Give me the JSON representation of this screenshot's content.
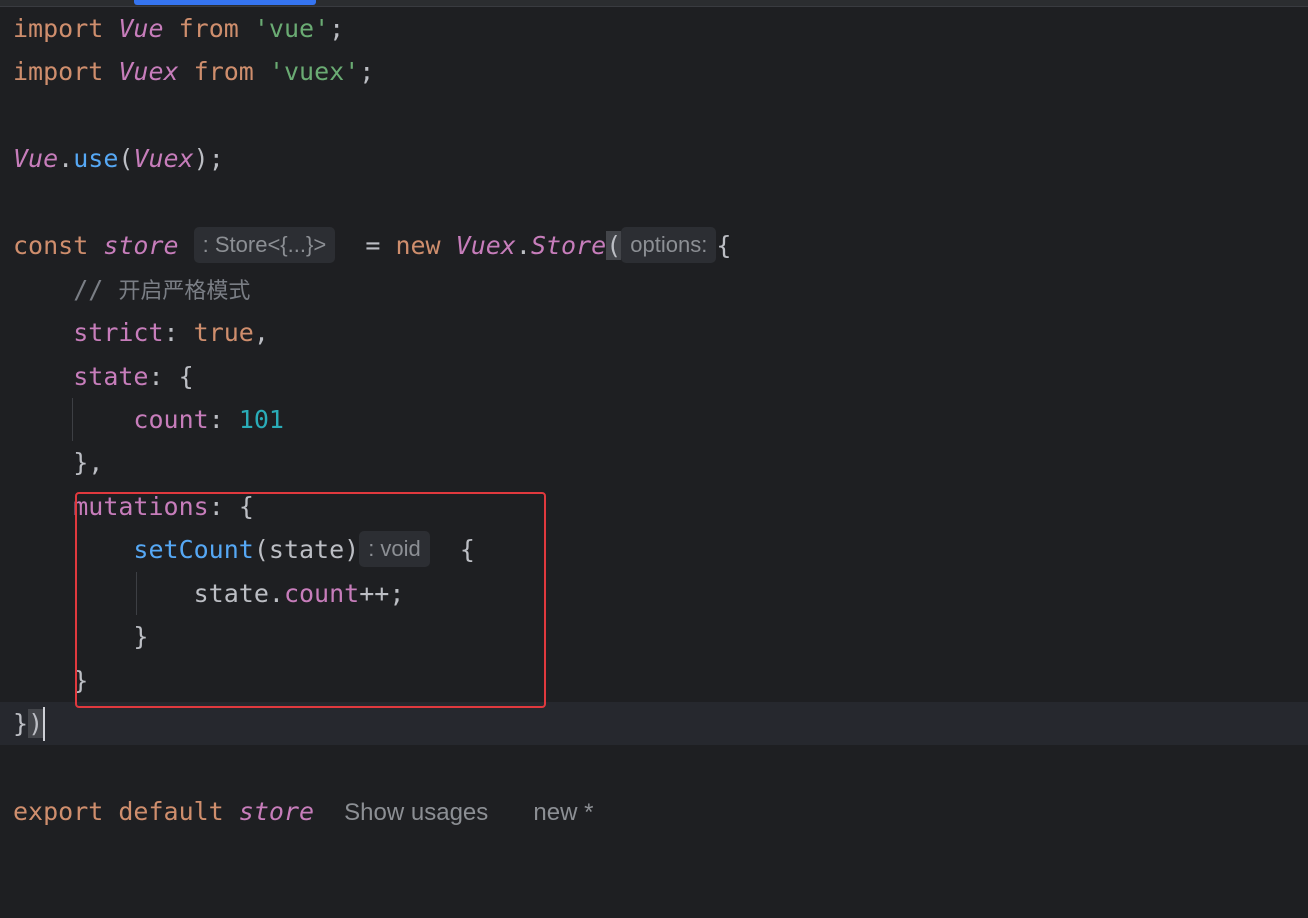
{
  "editor": {
    "lines": {
      "l1": {
        "kw": "import",
        "cls": "Vue",
        "kw2": "from",
        "str": "'vue'",
        "end": ";"
      },
      "l2": {
        "kw": "import",
        "cls": "Vuex",
        "kw2": "from",
        "str": "'vuex'",
        "end": ";"
      },
      "l4": {
        "cls": "Vue",
        "dot": ".",
        "fn": "use",
        "open": "(",
        "arg": "Vuex",
        "close": ");"
      },
      "l6": {
        "kw": "const",
        "var": "store",
        "type_hint": ": Store<{...}>",
        "eq": "=",
        "kw2": "new",
        "cls": "Vuex",
        "dot": ".",
        "ctor": "Store",
        "paren": "(",
        "param_hint": "options:",
        "brace": "{"
      },
      "l7": {
        "comment_slashes": "//",
        "comment_text": "开启严格模式"
      },
      "l8": {
        "key": "strict",
        "colon": ":",
        "val": "true",
        "end": ","
      },
      "l9": {
        "key": "state",
        "colon": ":",
        "brace": "{"
      },
      "l10": {
        "key": "count",
        "colon": ":",
        "val": "101"
      },
      "l11": {
        "text": "},"
      },
      "l12": {
        "key": "mutations",
        "colon": ":",
        "brace": "{"
      },
      "l13": {
        "fn": "setCount",
        "params": "(state)",
        "return_hint": ": void",
        "brace": "{"
      },
      "l14": {
        "obj": "state",
        "dot": ".",
        "prop": "count",
        "end": "++;"
      },
      "l15": {
        "text": "}"
      },
      "l16": {
        "text": "}"
      },
      "l17": {
        "brace": "}",
        "paren": ")"
      },
      "l19": {
        "kw": "export",
        "kw2": "default",
        "var": "store",
        "codelens_usages": "Show usages",
        "codelens_author": "new *"
      }
    }
  },
  "colors": {
    "background": "#1e1f22",
    "keyword": "#cf8e6d",
    "italic_identifier": "#c77dbb",
    "string": "#6aab73",
    "function": "#56a8f5",
    "number": "#2aacb8",
    "comment": "#7a7e85",
    "highlight_box": "#e0393e",
    "tab_indicator": "#3574f0"
  }
}
